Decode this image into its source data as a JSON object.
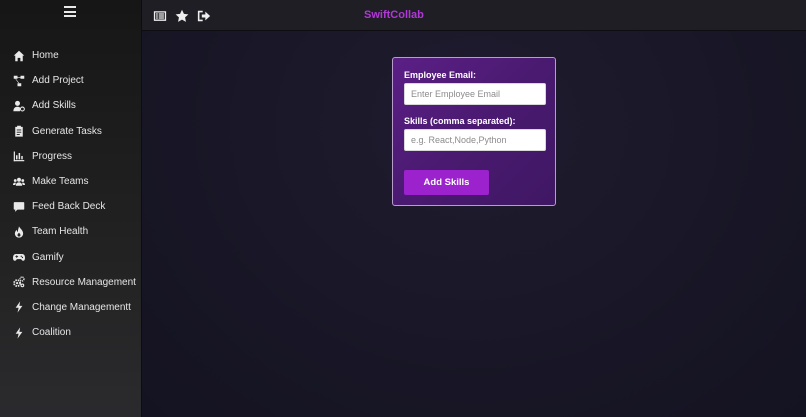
{
  "app": {
    "brand": "SwiftCollab"
  },
  "topbar": {
    "icons": [
      "list-icon",
      "star-icon",
      "sign-out-icon"
    ]
  },
  "sidebar": {
    "menu_icon": "hamburger-icon",
    "items": [
      {
        "label": "Home",
        "icon": "home-icon"
      },
      {
        "label": "Add Project",
        "icon": "project-diagram-icon"
      },
      {
        "label": "Add Skills",
        "icon": "user-cog-icon"
      },
      {
        "label": "Generate Tasks",
        "icon": "clipboard-icon"
      },
      {
        "label": "Progress",
        "icon": "chart-bar-icon"
      },
      {
        "label": "Make Teams",
        "icon": "users-icon"
      },
      {
        "label": "Feed Back Deck",
        "icon": "comment-icon"
      },
      {
        "label": "Team Health",
        "icon": "fire-icon"
      },
      {
        "label": "Gamify",
        "icon": "gamepad-icon"
      },
      {
        "label": "Resource Management",
        "icon": "cogs-icon"
      },
      {
        "label": "Change Managementt",
        "icon": "bolt-icon"
      },
      {
        "label": "Coalition",
        "icon": "bolt-icon"
      }
    ]
  },
  "form": {
    "email_label": "Employee Email:",
    "email_placeholder": "Enter Employee Email",
    "email_value": "",
    "skills_label": "Skills (comma separated):",
    "skills_placeholder": "e.g. React,Node,Python",
    "skills_value": "",
    "submit_label": "Add Skills"
  },
  "colors": {
    "brand": "#b237d8",
    "button": "#9b22cc",
    "card": "#4e1b76"
  }
}
